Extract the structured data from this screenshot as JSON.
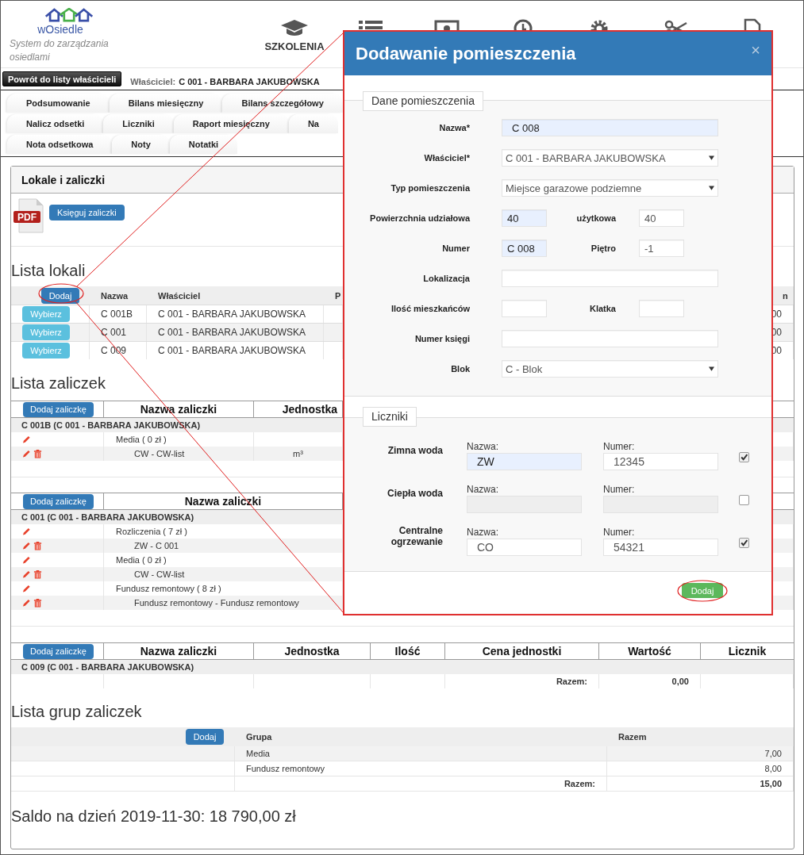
{
  "header": {
    "logo": "wOsiedle",
    "tagline": "System do zarządzania osiedlami",
    "nav": [
      {
        "kind": "cap",
        "label": "SZKOLENIA"
      },
      {
        "kind": "list"
      },
      {
        "kind": "money"
      },
      {
        "kind": "clock"
      },
      {
        "kind": "gear"
      },
      {
        "kind": "tools"
      },
      {
        "kind": "document"
      }
    ]
  },
  "back_button": "Powrót do listy właścicieli",
  "owner": {
    "label": "Właściciel:",
    "value": "C 001 - BARBARA JAKUBOWSKA"
  },
  "tab_rows": [
    [
      {
        "label": "Podsumowanie",
        "selected": false
      },
      {
        "label": "Bilans miesięczny",
        "selected": false
      },
      {
        "label": "Bilans szczegółowy",
        "selected": false
      }
    ],
    [
      {
        "label": "Nalicz odsetki",
        "selected": false
      },
      {
        "label": "Liczniki",
        "selected": false
      },
      {
        "label": "Raport miesięczny",
        "selected": false
      },
      {
        "label": "Na",
        "selected": false
      }
    ],
    [
      {
        "label": "Nota odsetkowa",
        "selected": false
      },
      {
        "label": "Noty",
        "selected": false
      },
      {
        "label": "Notatki",
        "selected": false
      }
    ]
  ],
  "panel": {
    "title": "Lokale i zaliczki",
    "pdf_label": "PDF",
    "post_button": "Księguj zaliczki"
  },
  "units": {
    "title": "Lista lokali",
    "add_button": "Dodaj",
    "columns": [
      "Nazwa",
      "Właściciel",
      "P",
      "n"
    ],
    "rows": [
      {
        "button": "Wybierz",
        "name": "C 001B",
        "owner": "C 001 - BARBARA JAKUBOWSKA",
        "column_5": "00"
      },
      {
        "button": "Wybierz",
        "name": "C 001",
        "owner": "C 001 - BARBARA JAKUBOWSKA",
        "column_5": "00"
      },
      {
        "button": "Wybierz",
        "name": "C 009",
        "owner": "C 001 - BARBARA JAKUBOWSKA",
        "column_5": "00"
      }
    ]
  },
  "advances": {
    "title": "Lista zaliczek",
    "tables": [
      {
        "add_button": "Dodaj zaliczkę",
        "columns": [
          "Nazwa zaliczki",
          "Jednostka"
        ],
        "group": "C 001B (C 001 - BARBARA JAKUBOWSKA)",
        "rows": [
          {
            "kind": "group",
            "name": "Media ( 0 zł )"
          },
          {
            "kind": "item",
            "name": "CW - CW-list",
            "unit": "m³"
          }
        ]
      },
      {
        "add_button": "Dodaj zaliczkę",
        "columns": [
          "Nazwa zaliczki"
        ],
        "group": "C 001 (C 001 - BARBARA JAKUBOWSKA)",
        "rows": [
          {
            "kind": "group",
            "name": "Rozliczenia ( 7 zł )"
          },
          {
            "kind": "item",
            "name": "ZW - C 001"
          },
          {
            "kind": "group",
            "name": "Media ( 0 zł )"
          },
          {
            "kind": "item",
            "name": "CW - CW-list"
          },
          {
            "kind": "group",
            "name": "Fundusz remontowy ( 8 zł )"
          },
          {
            "kind": "item",
            "name": "Fundusz remontowy - Fundusz remontowy"
          }
        ]
      },
      {
        "add_button": "Dodaj zaliczkę",
        "columns": [
          "Nazwa zaliczki",
          "Jednostka",
          "Ilość",
          "Cena jednostki",
          "Wartość",
          "Licznik"
        ],
        "group": "C 009 (C 001 - BARBARA JAKUBOWSKA)",
        "total_label": "Razem:",
        "total": "0,00"
      }
    ]
  },
  "groups": {
    "title": "Lista grup zaliczek",
    "add_button": "Dodaj",
    "columns": [
      "Grupa",
      "Razem"
    ],
    "rows": [
      {
        "name": "Media",
        "total": "7,00"
      },
      {
        "name": "Fundusz remontowy",
        "total": "8,00"
      }
    ],
    "total_label": "Razem:",
    "total": "15,00"
  },
  "balance": "Saldo na dzień 2019-11-30: 18 790,00 zł",
  "modal": {
    "title": "Dodawanie pomieszczenia",
    "close": "×",
    "section": "Dane pomieszczenia",
    "rows": [
      {
        "fields": [
          {
            "kind": "text",
            "label": "Nazwa*",
            "value": "C 008",
            "autofilled": true
          }
        ]
      },
      {
        "fields": [
          {
            "kind": "select",
            "label": "Właściciel*",
            "value": "C 001 - BARBARA JAKUBOWSKA"
          }
        ]
      },
      {
        "fields": [
          {
            "kind": "select",
            "label": "Typ pomieszczenia",
            "value": "Miejsce garazowe podziemne"
          }
        ]
      },
      {
        "fields": [
          {
            "kind": "text",
            "label": "Powierzchnia udziałowa",
            "value": "40",
            "autofilled": true
          },
          {
            "kind": "text",
            "label": "użytkowa",
            "value": "40",
            "autofilled": false
          }
        ]
      },
      {
        "fields": [
          {
            "kind": "text",
            "label": "Numer",
            "value": "C 008",
            "autofilled": true
          },
          {
            "kind": "text",
            "label": "Piętro",
            "value": "-1",
            "autofilled": false
          }
        ]
      },
      {
        "fields": [
          {
            "kind": "text",
            "label": "Lokalizacja",
            "autofilled": false
          }
        ]
      },
      {
        "fields": [
          {
            "kind": "text",
            "label": "Ilość mieszkańców",
            "autofilled": false
          },
          {
            "kind": "text",
            "label": "Klatka",
            "autofilled": false
          }
        ]
      },
      {
        "fields": [
          {
            "kind": "text",
            "label": "Numer księgi",
            "autofilled": false
          }
        ]
      },
      {
        "fields": [
          {
            "kind": "select",
            "label": "Blok",
            "value": "C - Blok"
          }
        ]
      }
    ],
    "meters_section": "Liczniki",
    "meters": [
      {
        "label": "Zimna woda",
        "name_label": "Nazwa:",
        "name": "ZW",
        "name_autofilled": true,
        "number_label": "Numer:",
        "number": "12345",
        "checked": true,
        "disabled": false
      },
      {
        "label": "Ciepła woda",
        "name_label": "Nazwa:",
        "name_autofilled": false,
        "number_label": "Numer:",
        "checked": false,
        "disabled": true
      },
      {
        "label": "Centralne ogrzewanie",
        "name_label": "Nazwa:",
        "name": "CO",
        "name_autofilled": false,
        "number_label": "Numer:",
        "number": "54321",
        "checked": true,
        "disabled": false
      }
    ],
    "submit": "Dodaj"
  }
}
